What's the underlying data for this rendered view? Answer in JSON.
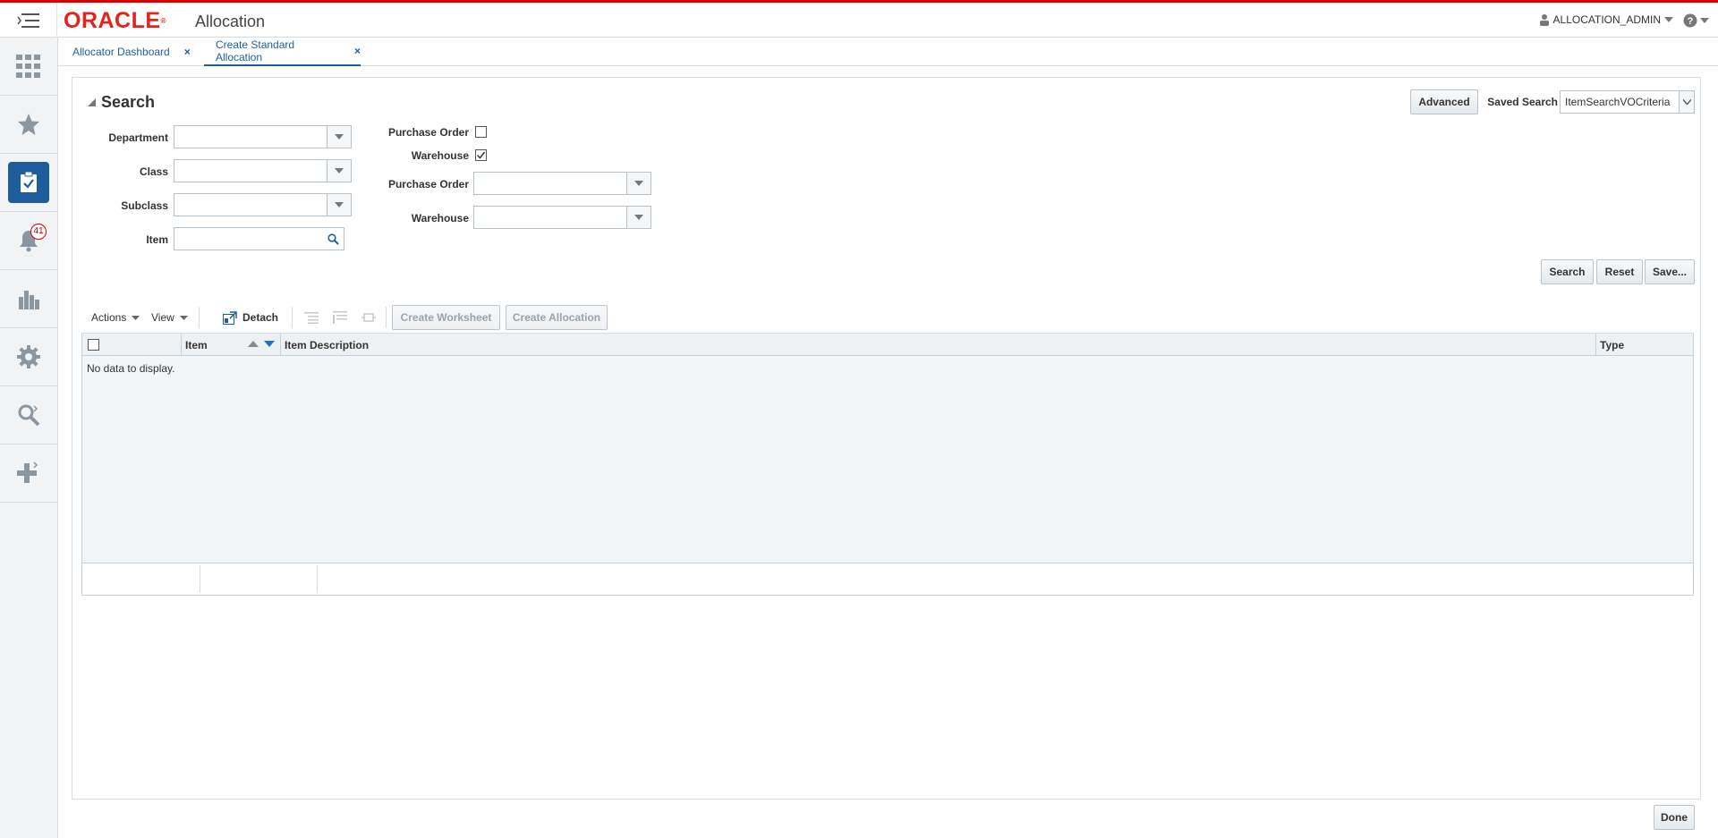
{
  "header": {
    "logo_text": "ORACLE",
    "app_title": "Allocation",
    "user_name": "ALLOCATION_ADMIN"
  },
  "sidebar": {
    "items": [
      {
        "name": "apps-grid-icon"
      },
      {
        "name": "star-icon"
      },
      {
        "name": "clipboard-check-icon"
      },
      {
        "name": "bell-icon",
        "badge": "41"
      },
      {
        "name": "bar-chart-icon"
      },
      {
        "name": "gear-icon"
      },
      {
        "name": "search-icon"
      },
      {
        "name": "add-icon"
      }
    ]
  },
  "tabs": [
    {
      "label": "Allocator Dashboard"
    },
    {
      "label": "Create Standard Allocation"
    }
  ],
  "search": {
    "title": "Search",
    "advanced_label": "Advanced",
    "saved_search_label": "Saved Search",
    "saved_search_value": "ItemSearchVOCriteria",
    "fields": {
      "department": "Department",
      "class": "Class",
      "subclass": "Subclass",
      "item": "Item",
      "purchase_order_check": "Purchase Order",
      "warehouse_check": "Warehouse",
      "purchase_order": "Purchase Order",
      "warehouse": "Warehouse"
    },
    "purchase_order_checked": false,
    "warehouse_checked": true,
    "search_button": "Search",
    "reset_button": "Reset",
    "save_button": "Save..."
  },
  "results": {
    "actions_label": "Actions",
    "view_label": "View",
    "detach_label": "Detach",
    "create_worksheet_label": "Create Worksheet",
    "create_allocation_label": "Create Allocation",
    "columns": [
      "Item",
      "Item Description",
      "Type"
    ],
    "empty_message": "No data to display."
  },
  "footer": {
    "done_label": "Done"
  }
}
